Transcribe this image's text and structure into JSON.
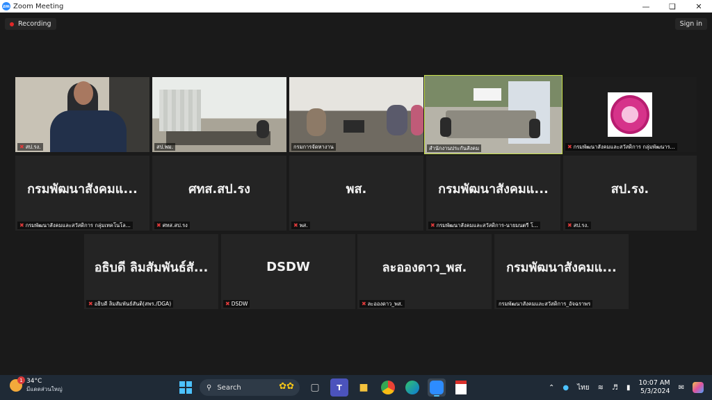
{
  "window": {
    "title": "Zoom Meeting",
    "app_icon": "zm"
  },
  "toolbar": {
    "recording": "Recording",
    "sign_in": "Sign in"
  },
  "tiles": [
    {
      "label": "สป.รง.",
      "video": true
    },
    {
      "label": "สป.พม.",
      "video": true
    },
    {
      "label": "กรมการจัดหางาน",
      "video": true
    },
    {
      "label": "สำนักงานประกันสังคม",
      "video": true,
      "active": true
    },
    {
      "label": "กรมพัฒนาสังคมและสวัสดิการ กลุ่มพัฒนาร...",
      "video": true
    },
    {
      "big": "กรมพัฒนาสังคมแ...",
      "label": "กรมพัฒนาสังคมและสวัสดิการ กลุ่มเทคโนโล..."
    },
    {
      "big": "ศทส.สป.รง",
      "label": "ศทส.สป.รง"
    },
    {
      "big": "พส.",
      "label": "พส."
    },
    {
      "big": "กรมพัฒนาสังคมแ...",
      "label": "กรมพัฒนาสังคมและสวัสดิการ-นายมนตรี โ..."
    },
    {
      "big": "สป.รง.",
      "label": "สป.รง."
    },
    {
      "big": "อธิบดี ลิมสัมพันธ์สั...",
      "label": "อธิบดี ลิมสัมพันธ์สันติ(สพร./DGA)"
    },
    {
      "big": "DSDW",
      "label": "DSDW"
    },
    {
      "big": "ละอองดาว_พส.",
      "label": "ละอองดาว_พส."
    },
    {
      "big": "กรมพัฒนาสังคมแ...",
      "label": "กรมพัฒนาสังคมและสวัสดิการ_อัจฉราพร"
    }
  ],
  "taskbar": {
    "weather_temp": "34°C",
    "weather_desc": "มีแดดส่วนใหญ่",
    "weather_badge": "1",
    "search_label": "Search",
    "lang": "ไทย",
    "time": "10:07 AM",
    "date": "5/3/2024",
    "apps": [
      "file-explorer-icon",
      "teams-icon",
      "folder-icon",
      "chrome-icon",
      "edge-icon",
      "zoom-icon",
      "pdf-icon"
    ]
  },
  "colors": {
    "active_speaker": "#c8e04a",
    "mute": "#e23b3b",
    "background": "#1a1a1a",
    "tile": "#242424"
  }
}
